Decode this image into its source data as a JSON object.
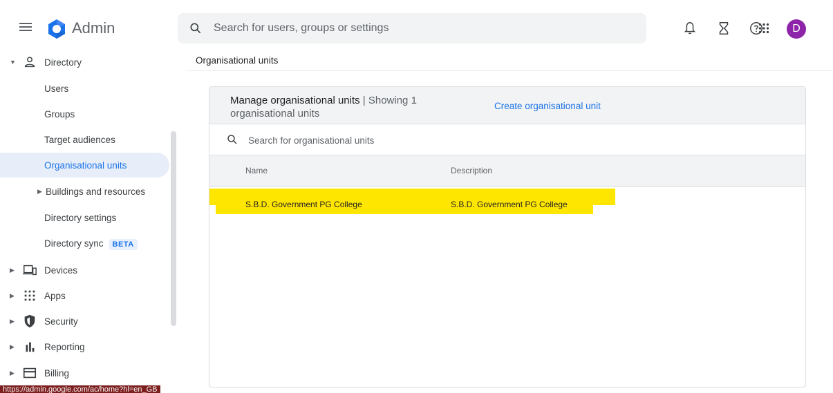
{
  "header": {
    "app_title": "Admin",
    "search_placeholder": "Search for users, groups or settings",
    "avatar_letter": "D",
    "icons": [
      "menu-icon",
      "admin-logo-icon",
      "search-icon",
      "notifications-icon",
      "tasks-hourglass-icon",
      "help-icon",
      "apps-grid-icon"
    ]
  },
  "sidebar": {
    "directory_label": "Directory",
    "directory_items": [
      {
        "label": "Users"
      },
      {
        "label": "Groups"
      },
      {
        "label": "Target audiences"
      },
      {
        "label": "Organisational units",
        "active": true
      },
      {
        "label": "Buildings and resources",
        "expandable": true
      },
      {
        "label": "Directory settings"
      },
      {
        "label": "Directory sync",
        "badge": "BETA"
      }
    ],
    "sections": [
      {
        "label": "Devices",
        "icon": "devices-icon"
      },
      {
        "label": "Apps",
        "icon": "apps-icon"
      },
      {
        "label": "Security",
        "icon": "security-shield-icon"
      },
      {
        "label": "Reporting",
        "icon": "reporting-icon"
      },
      {
        "label": "Billing",
        "icon": "billing-icon"
      }
    ]
  },
  "status_bar": {
    "url": "https://admin.google.com/ac/home?hl=en_GB"
  },
  "main": {
    "breadcrumb": "Organisational units",
    "card": {
      "title": "Manage organisational units",
      "subtitle": "| Showing 1 organisational units",
      "create_link": "Create organisational unit",
      "search_placeholder": "Search for organisational units",
      "columns": [
        "Name",
        "Description"
      ],
      "rows": [
        {
          "name": "S.B.D. Government PG College",
          "description": "S.B.D. Government PG College"
        }
      ]
    }
  },
  "colors": {
    "accent": "#1a73e8",
    "highlight": "#ffe600",
    "avatar": "#8e24aa"
  }
}
